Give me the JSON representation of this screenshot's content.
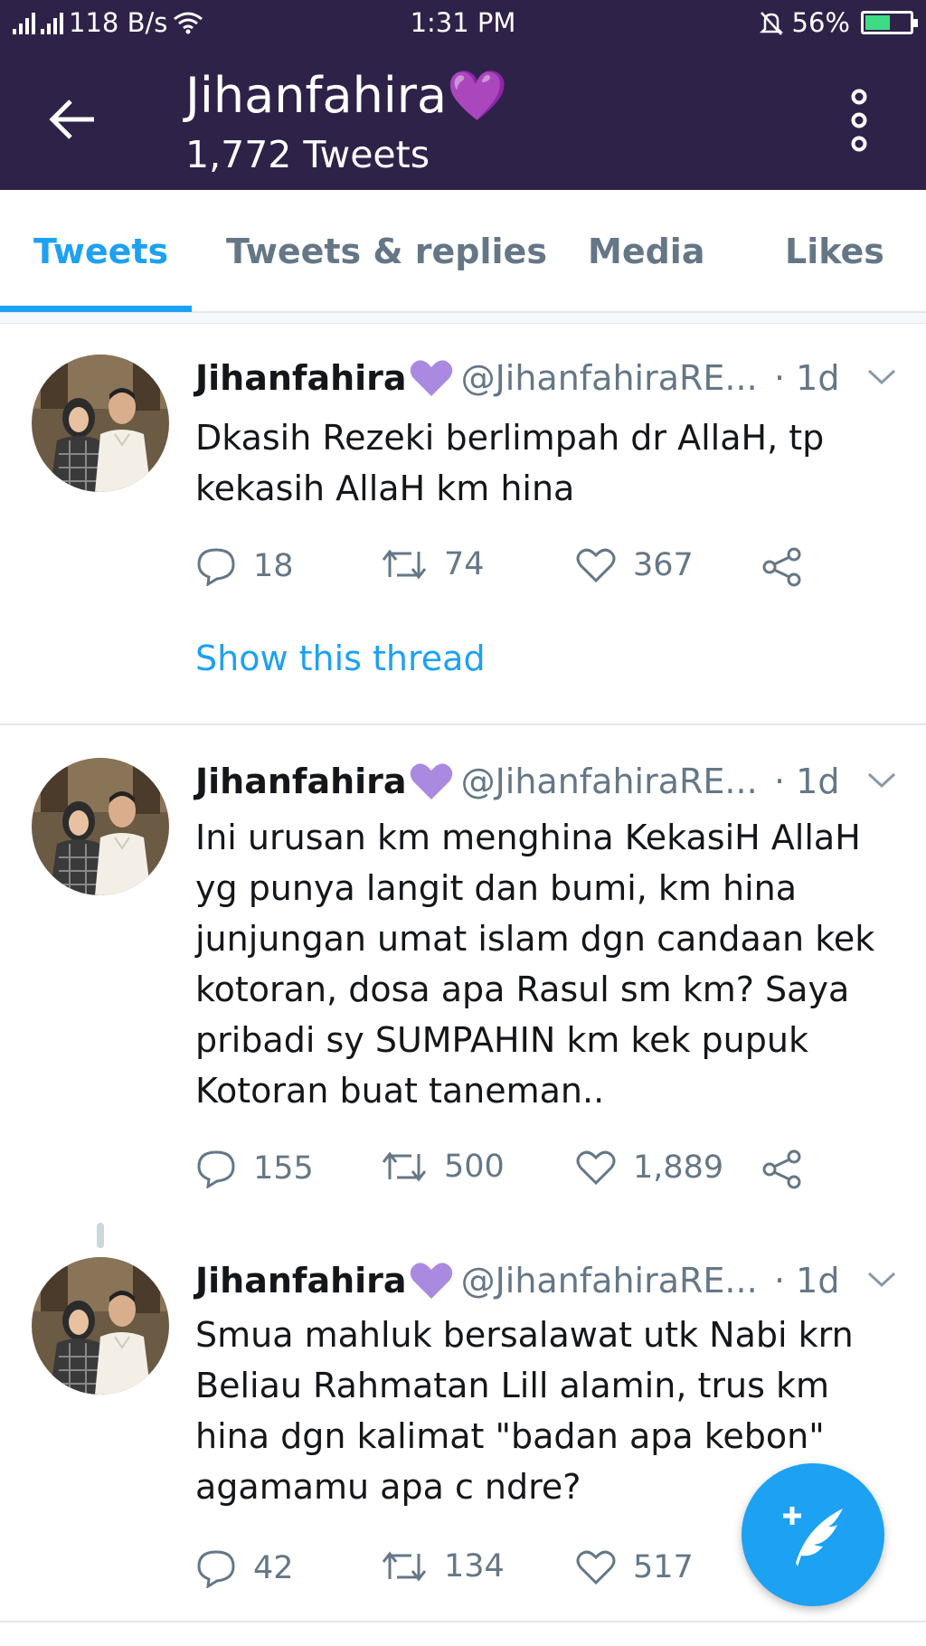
{
  "status_bar": {
    "network_speed": "118 B/s",
    "time": "1:31 PM",
    "battery": "56%",
    "battery_level": 0.56,
    "icons": [
      "signal-icon",
      "signal-icon",
      "wifi-icon",
      "mute-bell-icon",
      "battery-icon"
    ]
  },
  "header": {
    "title": "Jihanfahira💜",
    "subtitle": "1,772 Tweets",
    "back_icon": "back-arrow-icon",
    "menu_icon": "more-vertical-icon",
    "color": "#2e2249"
  },
  "tabs": [
    {
      "label": "Tweets",
      "active": true
    },
    {
      "label": "Tweets & replies",
      "active": false
    },
    {
      "label": "Media",
      "active": false
    },
    {
      "label": "Likes",
      "active": false
    }
  ],
  "accent_color": "#1da1f2",
  "tweets": [
    {
      "name": "Jihanfahira",
      "handle": "@JihanfahiraRE...",
      "time": "· 1d",
      "text": "Dkasih Rezeki berlimpah dr AllaH, tp kekasih AllaH km hina",
      "replies": "18",
      "retweets": "74",
      "likes": "367",
      "show_thread": "Show this thread"
    },
    {
      "name": "Jihanfahira",
      "handle": "@JihanfahiraRE...",
      "time": "· 1d",
      "text": "Ini urusan km menghina KekasiH AllaH yg punya langit dan bumi, km hina junjungan umat islam dgn candaan kek kotoran, dosa apa Rasul sm km? Saya pribadi sy SUMPAHIN km kek pupuk Kotoran buat taneman..",
      "replies": "155",
      "retweets": "500",
      "likes": "1,889"
    },
    {
      "name": "Jihanfahira",
      "handle": "@JihanfahiraRE...",
      "time": "· 1d",
      "text": "Smua mahluk bersalawat utk Nabi krn Beliau Rahmatan Lill alamin, trus km hina dgn kalimat \"badan apa kebon\" agamamu apa c ndre?",
      "replies": "42",
      "retweets": "134",
      "likes": "517"
    }
  ],
  "fab_icon": "compose-tweet-icon"
}
